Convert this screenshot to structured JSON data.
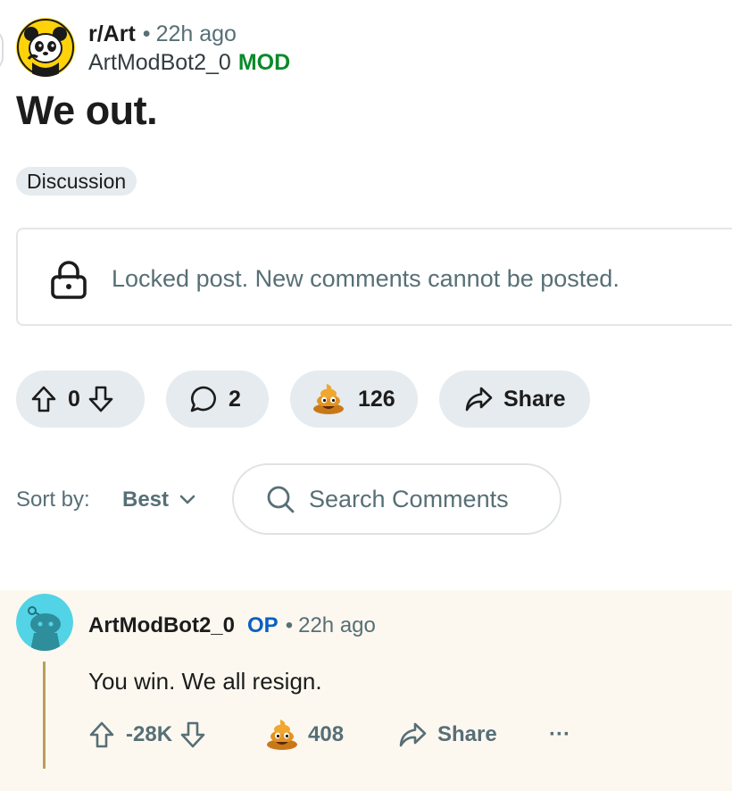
{
  "post": {
    "subreddit": "r/Art",
    "time": "22h ago",
    "author": "ArtModBot2_0",
    "author_badge": "MOD",
    "title": "We out.",
    "flair": "Discussion",
    "locked_message": "Locked post. New comments cannot be posted."
  },
  "actions": {
    "vote_count": "0",
    "comment_count": "2",
    "award_count": "126",
    "share_label": "Share"
  },
  "sort": {
    "label": "Sort by:",
    "value": "Best"
  },
  "search": {
    "placeholder": "Search Comments"
  },
  "comment": {
    "author": "ArtModBot2_0",
    "badge": "OP",
    "time": "22h ago",
    "body": "You win. We all resign.",
    "score": "-28K",
    "award_count": "408",
    "share_label": "Share",
    "more": "···"
  },
  "colors": {
    "mod_green": "#0a8a2a",
    "op_blue": "#0a5fc2",
    "pill_bg": "#e5ebee",
    "comment_bg": "#fcf8f0",
    "thread_line": "#b8a05a",
    "avatar_yellow": "#ffd20a",
    "avatar_cyan": "#53d3e6"
  },
  "icons": {
    "subreddit_avatar": "panda-avatar-icon",
    "lock": "lock-icon",
    "upvote": "arrow-up-icon",
    "downvote": "arrow-down-icon",
    "comments": "speech-bubble-icon",
    "award": "poop-award-icon",
    "share": "share-arrow-icon",
    "search": "search-icon",
    "sort": "chevron-down-icon",
    "user_avatar": "snoo-avatar-icon"
  }
}
